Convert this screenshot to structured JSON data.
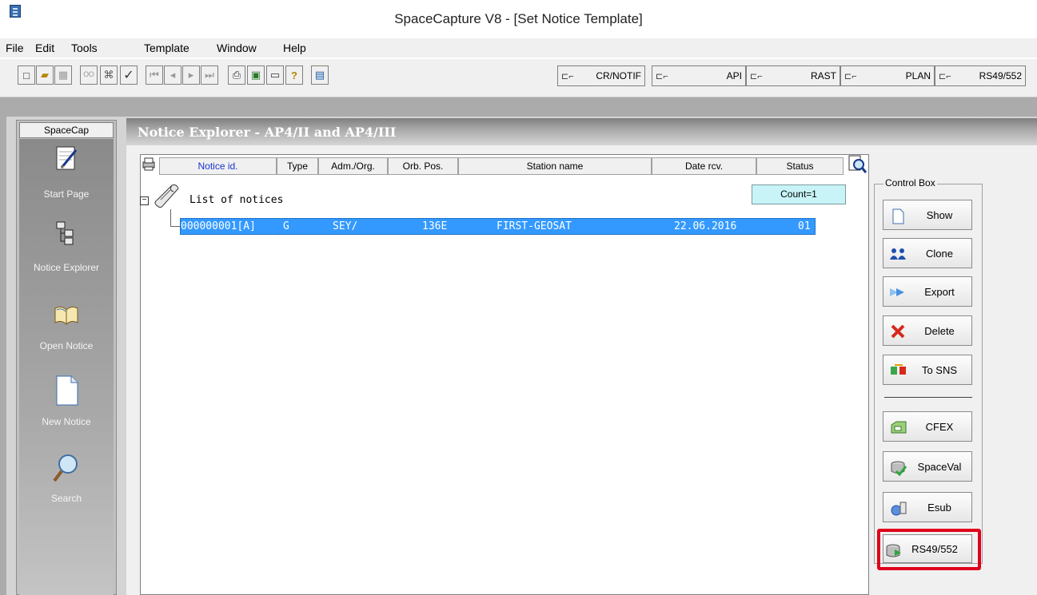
{
  "window": {
    "title": "SpaceCapture V8 - [Set Notice Template]"
  },
  "menu": [
    "File",
    "Edit",
    "Tools",
    "Template",
    "Window",
    "Help"
  ],
  "toolbar": {
    "tabs": [
      {
        "label": "CR/NOTIF"
      },
      {
        "label": "API"
      },
      {
        "label": "RAST"
      },
      {
        "label": "PLAN"
      },
      {
        "label": "RS49/552"
      }
    ]
  },
  "sidebar": {
    "tab": "SpaceCap",
    "items": [
      {
        "label": "Start Page",
        "icon": "notepad-pen-icon"
      },
      {
        "label": "Notice Explorer",
        "icon": "tree-icon"
      },
      {
        "label": "Open Notice",
        "icon": "open-book-icon"
      },
      {
        "label": "New Notice",
        "icon": "blank-page-icon"
      },
      {
        "label": "Search",
        "icon": "magnifier-icon"
      }
    ]
  },
  "explorer": {
    "title": "Notice Explorer - AP4/II and AP4/III",
    "columns": [
      "Notice id.",
      "Type",
      "Adm./Org.",
      "Orb. Pos.",
      "Station name",
      "Date rcv.",
      "Status"
    ],
    "count": "Count=1",
    "root_label": "List of notices",
    "rows": [
      {
        "notice_id": "000000001[A]",
        "type": "G",
        "adm": "SEY/",
        "orb_pos": "136E",
        "station": "FIRST-GEOSAT",
        "date": "22.06.2016",
        "status": "01"
      }
    ]
  },
  "control_box": {
    "label": "Control Box",
    "buttons": [
      {
        "label": "Show"
      },
      {
        "label": "Clone"
      },
      {
        "label": "Export"
      },
      {
        "label": "Delete"
      },
      {
        "label": "To SNS"
      },
      {
        "label": "CFEX"
      },
      {
        "label": "SpaceVal"
      },
      {
        "label": "Esub"
      },
      {
        "label": "RS49/552"
      }
    ]
  },
  "colors": {
    "selection": "#3399ff",
    "highlight": "#e0001a",
    "count_bg": "#c8f4f8"
  }
}
